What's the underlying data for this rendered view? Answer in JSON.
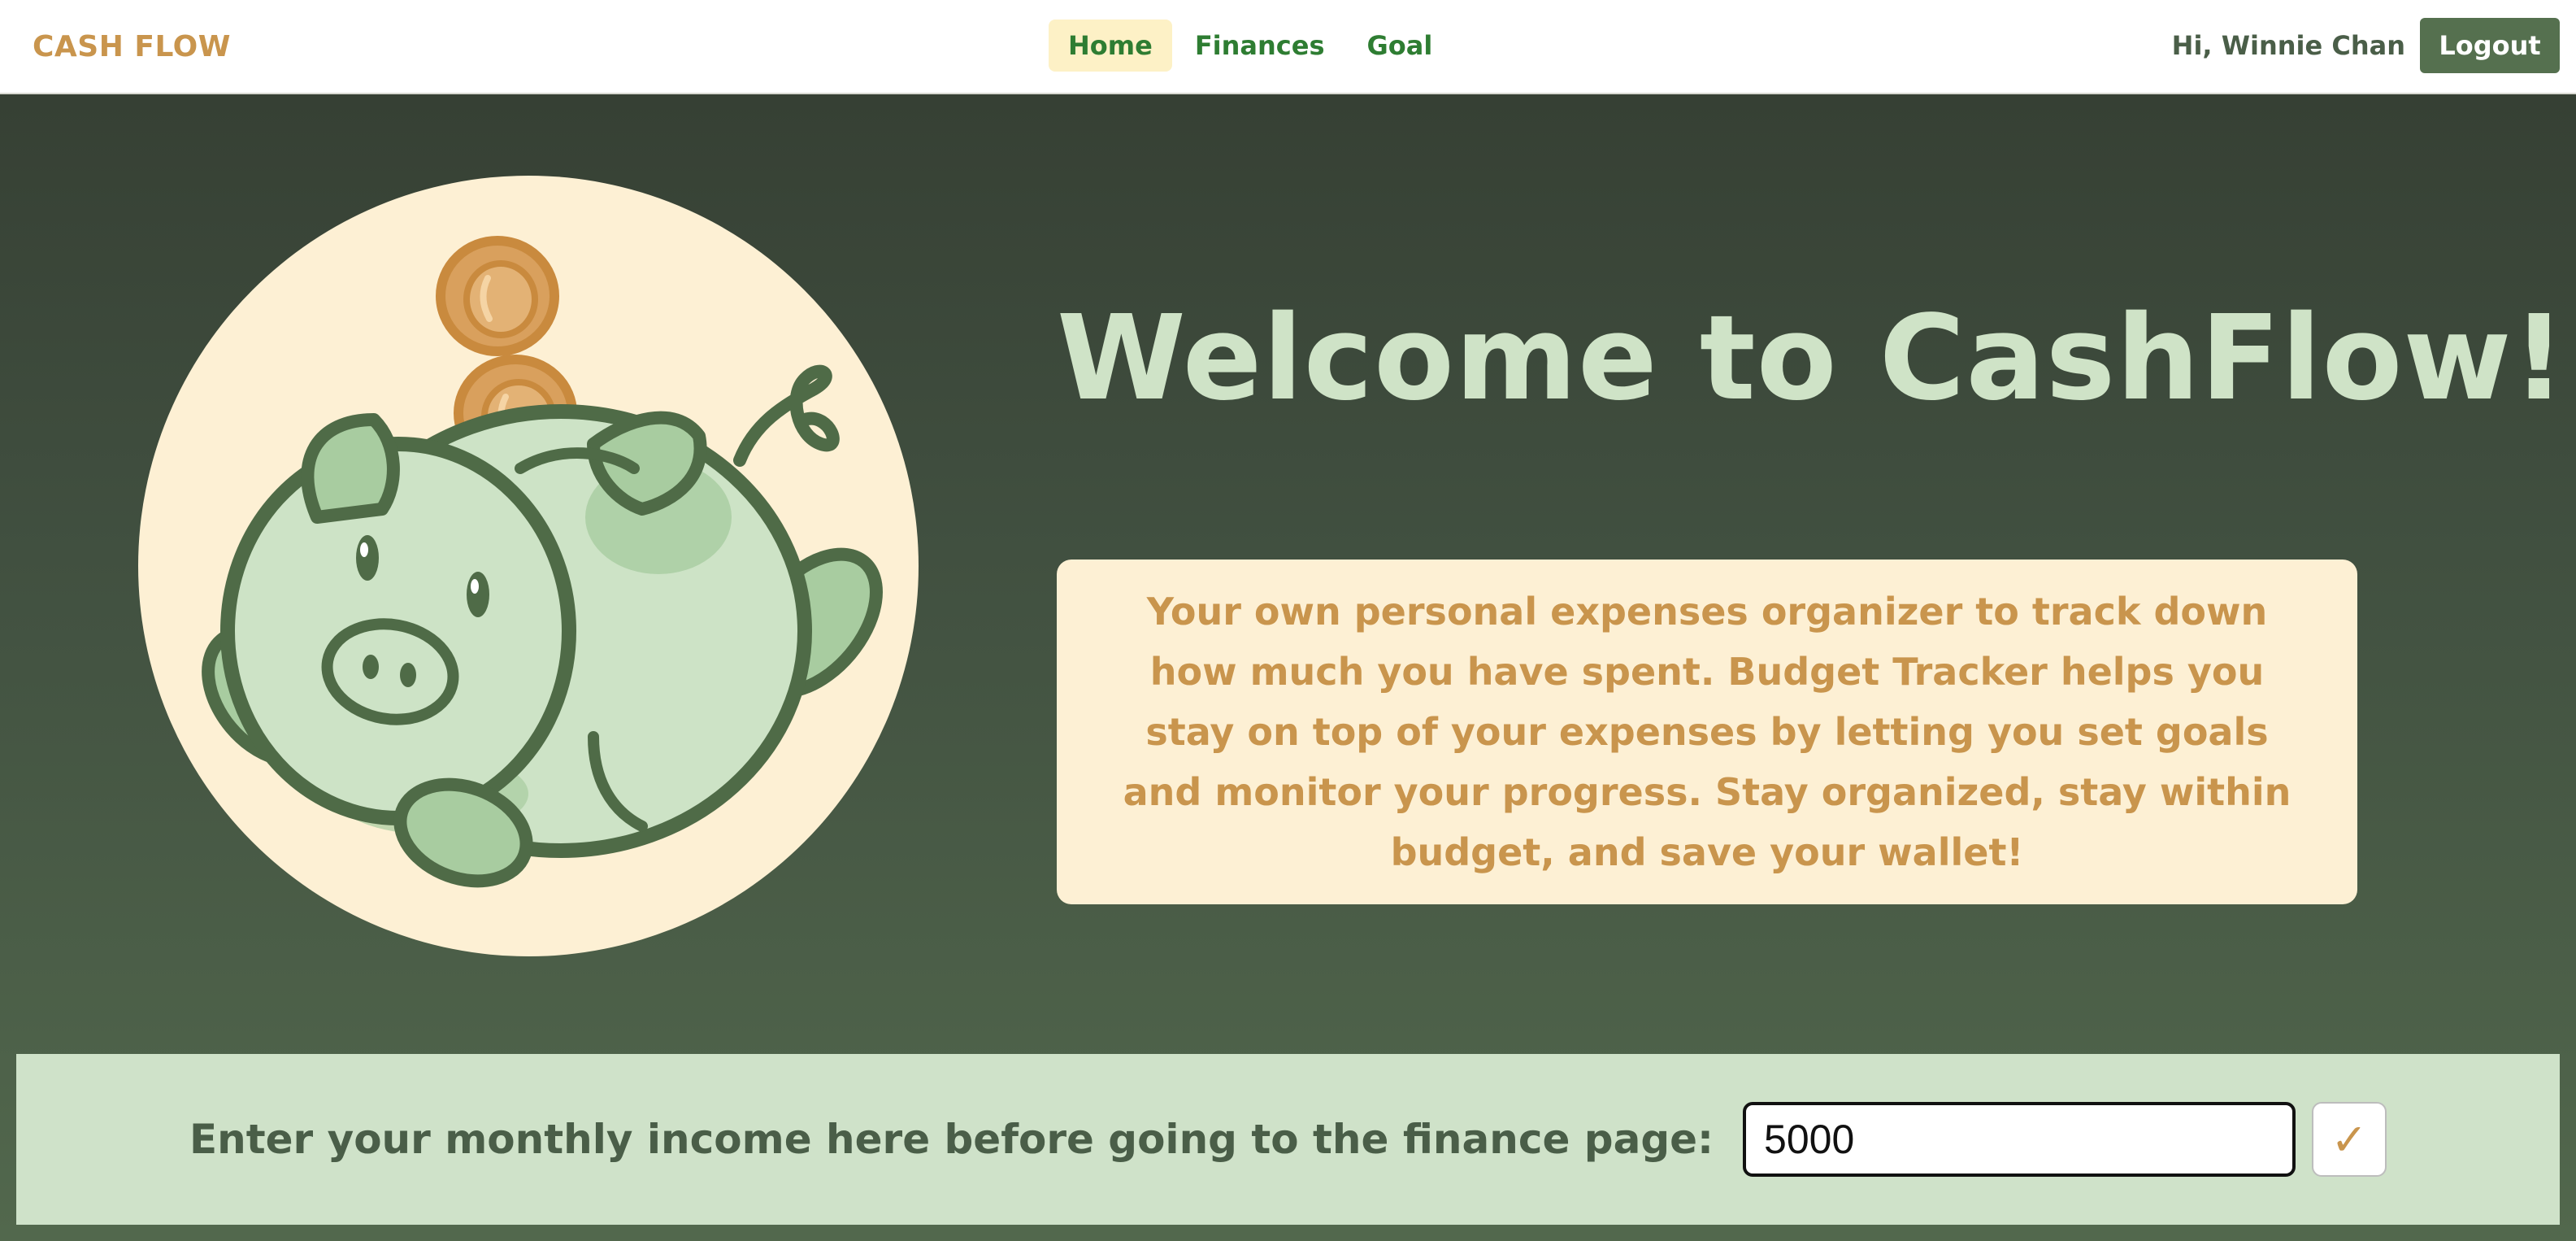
{
  "nav": {
    "brand": "CASH FLOW",
    "links": [
      {
        "label": "Home",
        "active": true
      },
      {
        "label": "Finances",
        "active": false
      },
      {
        "label": "Goal",
        "active": false
      }
    ],
    "greeting": "Hi, Winnie Chan",
    "logout_label": "Logout"
  },
  "hero": {
    "title": "Welcome to CashFlow!",
    "description": "Your own personal expenses organizer to track down how much you have spent. Budget Tracker helps you stay on top of your expenses by letting you set goals and monitor your progress. Stay organized, stay within budget, and save your wallet!",
    "illustration": "piggy-bank-with-coins"
  },
  "income": {
    "label": "Enter your monthly income here before going to the finance page:",
    "value": "5000",
    "submit_icon": "checkmark-icon",
    "submit_glyph": "✓"
  },
  "colors": {
    "brand": "#c9954d",
    "nav_link": "#2e7d32",
    "active_tab_bg": "#fdf1c6",
    "hero_bg_top": "#364034",
    "hero_bg_bottom": "#52684d",
    "title": "#cfe3c7",
    "card_bg": "#fdf0d4",
    "income_bar_bg": "#cfe2c9",
    "logout_bg": "#55704f"
  }
}
